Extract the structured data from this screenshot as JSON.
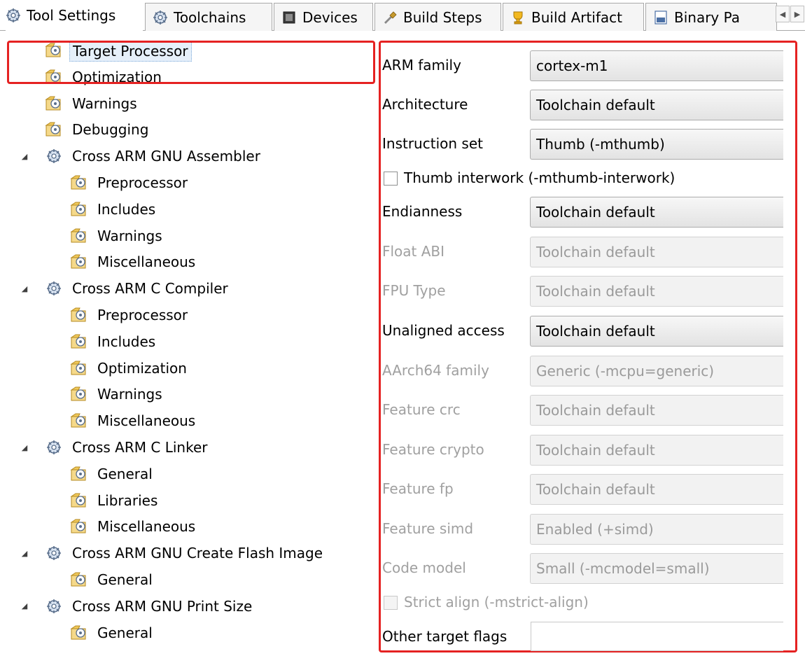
{
  "tabs": [
    {
      "label": "Tool Settings",
      "icon": "tool-gear-icon",
      "active": true
    },
    {
      "label": "Toolchains",
      "icon": "toolchain-gear-icon"
    },
    {
      "label": "Devices",
      "icon": "device-chip-icon"
    },
    {
      "label": "Build Steps",
      "icon": "build-steps-icon"
    },
    {
      "label": "Build Artifact",
      "icon": "build-artifact-icon"
    },
    {
      "label": "Binary Pa",
      "icon": "binary-parser-icon"
    }
  ],
  "tab_scroll": {
    "left": "◀",
    "right": "▶"
  },
  "tree": [
    {
      "label": "Target Processor",
      "icon": "folder-settings-icon",
      "level": 1,
      "selected": true
    },
    {
      "label": "Optimization",
      "icon": "folder-settings-icon",
      "level": 1
    },
    {
      "label": "Warnings",
      "icon": "folder-settings-icon",
      "level": 1
    },
    {
      "label": "Debugging",
      "icon": "folder-settings-icon",
      "level": 1
    },
    {
      "label": "Cross ARM GNU Assembler",
      "icon": "tool-gear-icon",
      "level": 0,
      "expanded": true
    },
    {
      "label": "Preprocessor",
      "icon": "folder-settings-icon",
      "level": 2
    },
    {
      "label": "Includes",
      "icon": "folder-settings-icon",
      "level": 2
    },
    {
      "label": "Warnings",
      "icon": "folder-settings-icon",
      "level": 2
    },
    {
      "label": "Miscellaneous",
      "icon": "folder-settings-icon",
      "level": 2
    },
    {
      "label": "Cross ARM C Compiler",
      "icon": "tool-gear-icon",
      "level": 0,
      "expanded": true
    },
    {
      "label": "Preprocessor",
      "icon": "folder-settings-icon",
      "level": 2
    },
    {
      "label": "Includes",
      "icon": "folder-settings-icon",
      "level": 2
    },
    {
      "label": "Optimization",
      "icon": "folder-settings-icon",
      "level": 2
    },
    {
      "label": "Warnings",
      "icon": "folder-settings-icon",
      "level": 2
    },
    {
      "label": "Miscellaneous",
      "icon": "folder-settings-icon",
      "level": 2
    },
    {
      "label": "Cross ARM C Linker",
      "icon": "tool-gear-icon",
      "level": 0,
      "expanded": true
    },
    {
      "label": "General",
      "icon": "folder-settings-icon",
      "level": 2
    },
    {
      "label": "Libraries",
      "icon": "folder-settings-icon",
      "level": 2
    },
    {
      "label": "Miscellaneous",
      "icon": "folder-settings-icon",
      "level": 2
    },
    {
      "label": "Cross ARM GNU Create Flash Image",
      "icon": "tool-gear-icon",
      "level": 0,
      "expanded": true
    },
    {
      "label": "General",
      "icon": "folder-settings-icon",
      "level": 2
    },
    {
      "label": "Cross ARM GNU Print Size",
      "icon": "tool-gear-icon",
      "level": 0,
      "expanded": true
    },
    {
      "label": "General",
      "icon": "folder-settings-icon",
      "level": 2
    }
  ],
  "form": {
    "rows": [
      {
        "type": "combo",
        "label": "ARM family",
        "value": "cortex-m1",
        "enabled": true
      },
      {
        "type": "combo",
        "label": "Architecture",
        "value": "Toolchain default",
        "enabled": true
      },
      {
        "type": "combo",
        "label": "Instruction set",
        "value": "Thumb (-mthumb)",
        "enabled": true
      },
      {
        "type": "check",
        "label": "Thumb interwork (-mthumb-interwork)",
        "checked": false,
        "enabled": true
      },
      {
        "type": "combo",
        "label": "Endianness",
        "value": "Toolchain default",
        "enabled": true
      },
      {
        "type": "combo",
        "label": "Float ABI",
        "value": "Toolchain default",
        "enabled": false
      },
      {
        "type": "combo",
        "label": "FPU Type",
        "value": "Toolchain default",
        "enabled": false
      },
      {
        "type": "combo",
        "label": "Unaligned access",
        "value": "Toolchain default",
        "enabled": true
      },
      {
        "type": "combo",
        "label": "AArch64 family",
        "value": "Generic (-mcpu=generic)",
        "enabled": false
      },
      {
        "type": "combo",
        "label": "Feature crc",
        "value": "Toolchain default",
        "enabled": false
      },
      {
        "type": "combo",
        "label": "Feature crypto",
        "value": "Toolchain default",
        "enabled": false
      },
      {
        "type": "combo",
        "label": "Feature fp",
        "value": "Toolchain default",
        "enabled": false
      },
      {
        "type": "combo",
        "label": "Feature simd",
        "value": "Enabled (+simd)",
        "enabled": false
      },
      {
        "type": "combo",
        "label": "Code model",
        "value": "Small (-mcmodel=small)",
        "enabled": false
      },
      {
        "type": "check",
        "label": "Strict align (-mstrict-align)",
        "checked": false,
        "enabled": false
      },
      {
        "type": "text",
        "label": "Other target flags",
        "value": "",
        "enabled": true
      }
    ]
  },
  "colors": {
    "highlight_box": "#e52222",
    "disabled_text": "#a0a0a0"
  }
}
